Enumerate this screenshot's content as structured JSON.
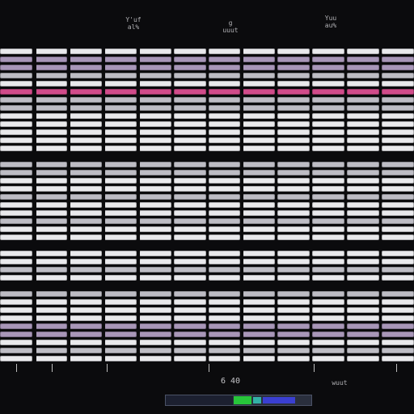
{
  "top_labels": {
    "left": "Y'uf\nal%",
    "center": "g\nuuut",
    "right": "Yuu\nau%"
  },
  "bottom_labels": {
    "center": "6 40",
    "right": "wuut"
  },
  "status": {
    "progress": 0.46
  }
}
